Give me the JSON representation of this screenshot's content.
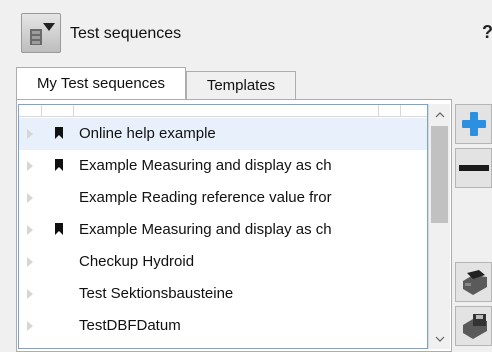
{
  "header": {
    "title": "Test sequences",
    "help": "?"
  },
  "tabs": [
    {
      "label": "My Test sequences",
      "active": true
    },
    {
      "label": "Templates",
      "active": false
    }
  ],
  "list": {
    "items": [
      {
        "label": "Online help example",
        "bookmarked": true,
        "selected": true
      },
      {
        "label": "Example Measuring and display as ch",
        "bookmarked": true,
        "selected": false
      },
      {
        "label": "Example Reading reference value fror",
        "bookmarked": false,
        "selected": false
      },
      {
        "label": "Example Measuring and display as ch",
        "bookmarked": true,
        "selected": false
      },
      {
        "label": "Checkup Hydroid",
        "bookmarked": false,
        "selected": false
      },
      {
        "label": "Test Sektionsbausteine",
        "bookmarked": false,
        "selected": false
      },
      {
        "label": "TestDBFDatum",
        "bookmarked": false,
        "selected": false
      }
    ]
  },
  "toolbar": {
    "add_icon": "plus-icon",
    "remove_icon": "minus-icon",
    "open_icon": "open-folder-icon",
    "save_icon": "save-icon"
  },
  "colors": {
    "list_border": "#7aa3d6",
    "add_blue": "#2d8fe0",
    "bookmark": "#111111"
  }
}
